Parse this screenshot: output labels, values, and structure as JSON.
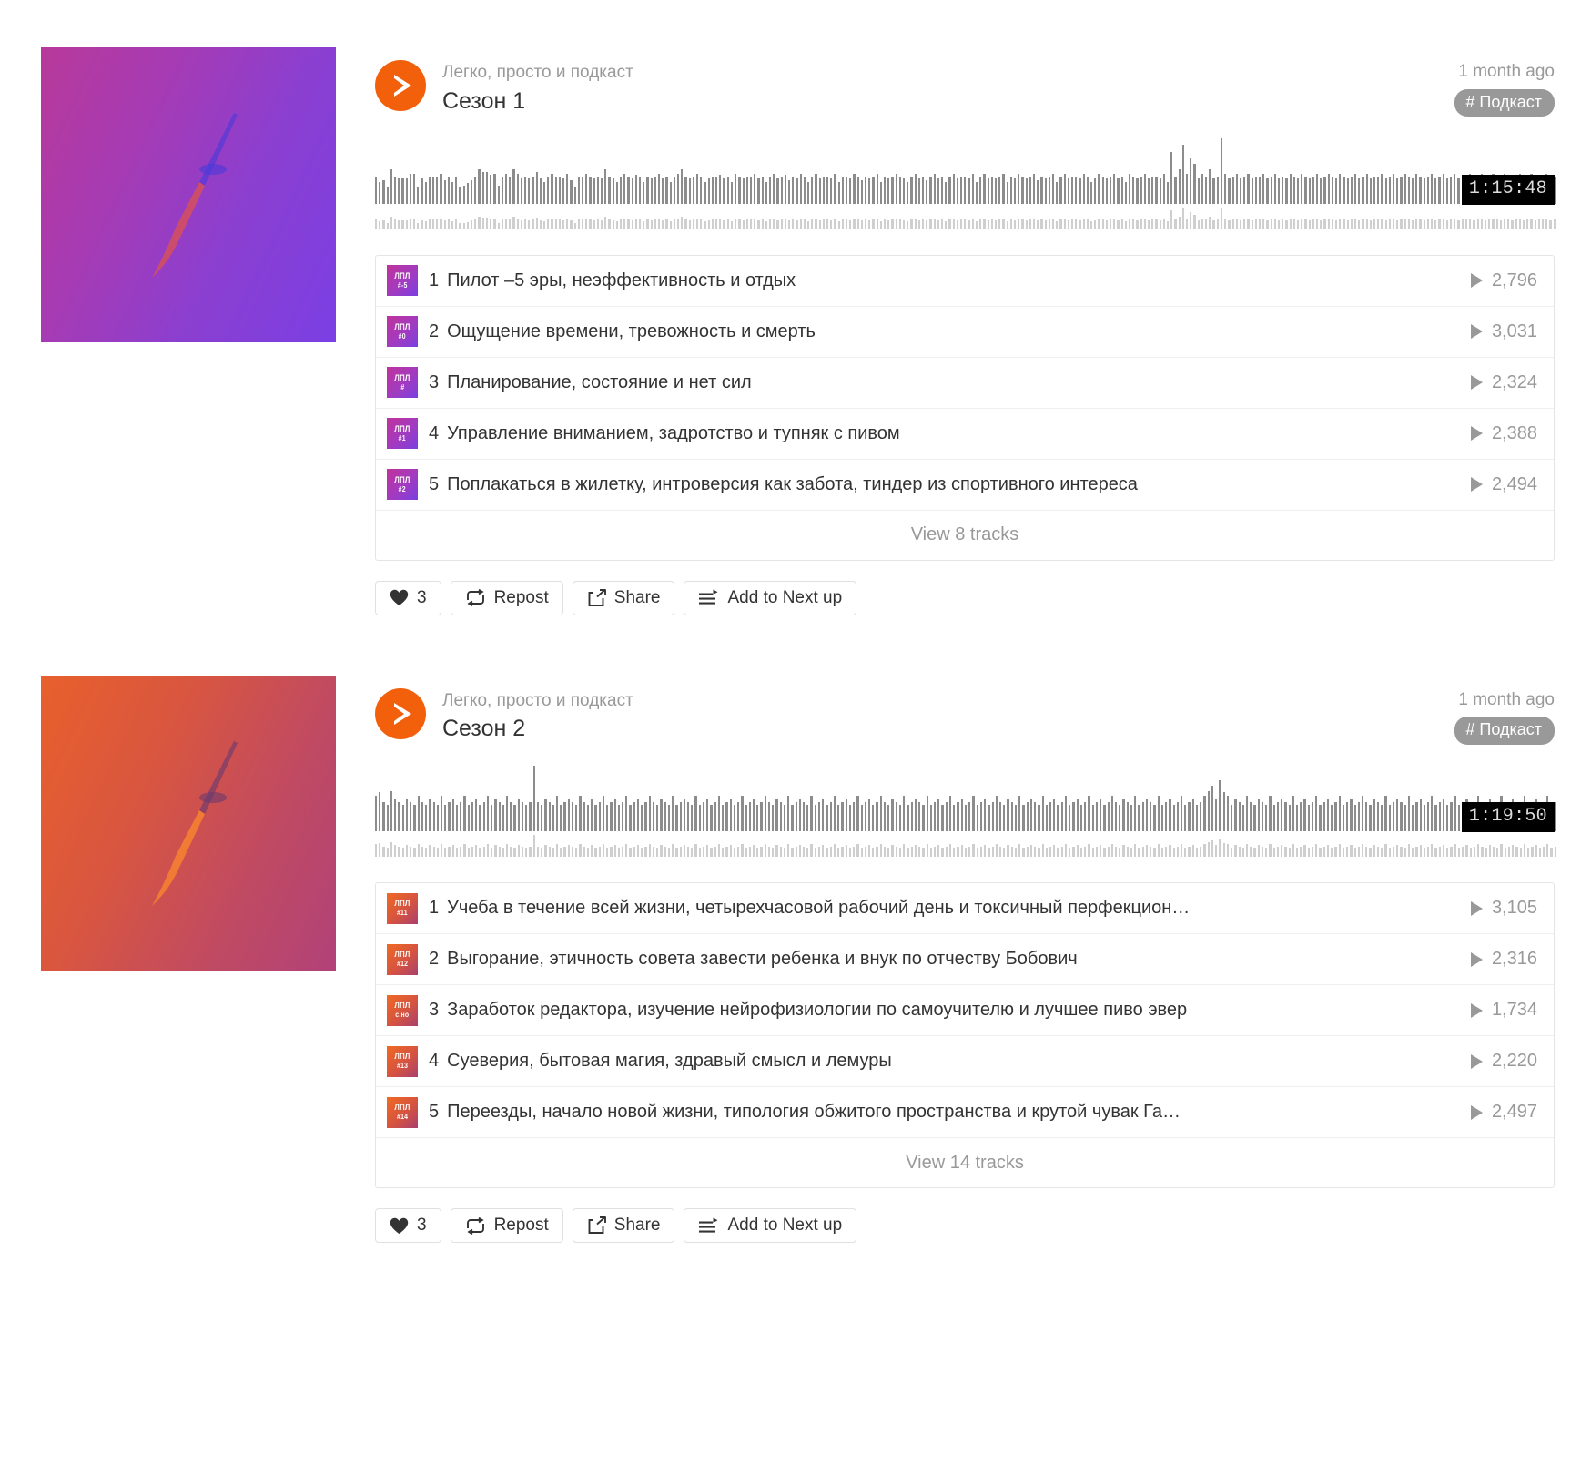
{
  "playlists": [
    {
      "artist": "Легко, просто и подкаст",
      "title": "Сезон 1",
      "ago": "1 month ago",
      "tag": "# Подкаст",
      "duration": "1:15:48",
      "artwork_colors": {
        "from": "#b8399a",
        "to": "#7b3fe4"
      },
      "view_all": "View 8 tracks",
      "tracks": [
        {
          "num": "1",
          "title": "Пилот –5 эры, неэффективность и отдых",
          "plays": "2,796",
          "thumb_line1": "ЛПЛ",
          "thumb_line2": "#-5"
        },
        {
          "num": "2",
          "title": "Ощущение времени, тревожность и смерть",
          "plays": "3,031",
          "thumb_line1": "ЛПЛ",
          "thumb_line2": "#0"
        },
        {
          "num": "3",
          "title": "Планирование, состояние и нет сил",
          "plays": "2,324",
          "thumb_line1": "ЛПЛ",
          "thumb_line2": "#"
        },
        {
          "num": "4",
          "title": "Управление вниманием, задротство и тупняк с пивом",
          "plays": "2,388",
          "thumb_line1": "ЛПЛ",
          "thumb_line2": "#1"
        },
        {
          "num": "5",
          "title": "Поплакаться в жилетку, интроверсия как забота, тиндер из спортивного интереса",
          "plays": "2,494",
          "thumb_line1": "ЛПЛ",
          "thumb_line2": "#2"
        }
      ],
      "actions": {
        "likes": "3",
        "repost": "Repost",
        "share": "Share",
        "next_up": "Add to Next up"
      }
    },
    {
      "artist": "Легко, просто и подкаст",
      "title": "Сезон 2",
      "ago": "1 month ago",
      "tag": "# Подкаст",
      "duration": "1:19:50",
      "artwork_colors": {
        "from": "#e8602c",
        "to": "#b14279"
      },
      "view_all": "View 14 tracks",
      "tracks": [
        {
          "num": "1",
          "title": "Учеба в течение всей жизни, четырехчасовой рабочий день и токсичный перфекцион…",
          "plays": "3,105",
          "thumb_line1": "ЛПЛ",
          "thumb_line2": "#11"
        },
        {
          "num": "2",
          "title": "Выгорание, этичность совета завести ребенка и внук по отчеству Бобович",
          "plays": "2,316",
          "thumb_line1": "ЛПЛ",
          "thumb_line2": "#12"
        },
        {
          "num": "3",
          "title": "Заработок редактора, изучение нейрофизиологии по самоучителю и лучшее пиво эвер",
          "plays": "1,734",
          "thumb_line1": "ЛПЛ",
          "thumb_line2": "с.но"
        },
        {
          "num": "4",
          "title": "Суеверия, бытовая магия, здравый смысл и лемуры",
          "plays": "2,220",
          "thumb_line1": "ЛПЛ",
          "thumb_line2": "#13"
        },
        {
          "num": "5",
          "title": "Переезды, начало новой жизни, типология обжитого пространства и крутой чувак Га…",
          "plays": "2,497",
          "thumb_line1": "ЛПЛ",
          "thumb_line2": "#14"
        }
      ],
      "actions": {
        "likes": "3",
        "repost": "Repost",
        "share": "Share",
        "next_up": "Add to Next up"
      }
    }
  ],
  "icons": {
    "play": "play-icon",
    "heart": "heart-icon",
    "repost": "repost-icon",
    "share": "share-icon",
    "next_up": "add-to-next-up-icon"
  },
  "waveforms": {
    "s1": [
      41,
      33,
      36,
      26,
      52,
      41,
      38,
      38,
      38,
      45,
      45,
      26,
      38,
      33,
      41,
      41,
      41,
      45,
      36,
      41,
      33,
      41,
      26,
      27,
      31,
      36,
      41,
      52,
      48,
      48,
      44,
      45,
      27,
      41,
      45,
      41,
      52,
      45,
      38,
      41,
      38,
      41,
      48,
      38,
      33,
      41,
      45,
      41,
      41,
      38,
      45,
      36,
      26,
      41,
      41,
      45,
      41,
      38,
      41,
      38,
      52,
      41,
      38,
      33,
      41,
      45,
      41,
      38,
      44,
      41,
      33,
      41,
      38,
      41,
      45,
      38,
      41,
      33,
      41,
      45,
      52,
      41,
      38,
      41,
      45,
      41,
      33,
      38,
      41,
      41,
      44,
      38,
      41,
      33,
      45,
      41,
      38,
      41,
      41,
      45,
      38,
      41,
      33,
      41,
      45,
      38,
      41,
      44,
      36,
      41,
      38,
      45,
      41,
      33,
      41,
      45,
      38,
      41,
      41,
      38,
      45,
      33,
      41,
      41,
      38,
      45,
      41,
      36,
      41,
      38,
      41,
      45,
      33,
      41,
      38,
      41,
      45,
      41,
      38,
      33,
      41,
      45,
      38,
      41,
      36,
      41,
      45,
      38,
      41,
      33,
      41,
      45,
      38,
      41,
      41,
      38,
      45,
      33,
      41,
      45,
      38,
      41,
      38,
      41,
      45,
      33,
      41,
      38,
      45,
      41,
      38,
      41,
      45,
      36,
      41,
      38,
      41,
      45,
      33,
      41,
      45,
      38,
      41,
      41,
      38,
      45,
      41,
      33,
      38,
      45,
      41,
      38,
      41,
      45,
      38,
      41,
      33,
      45,
      41,
      38,
      41,
      45,
      38,
      41,
      41,
      38,
      45,
      33,
      78,
      41,
      52,
      90,
      45,
      70,
      60,
      38,
      45,
      41,
      52,
      38,
      41,
      100,
      45,
      38,
      41,
      45,
      38,
      41,
      45,
      38,
      41,
      41,
      45,
      38,
      41,
      45,
      38,
      41,
      38,
      45,
      41,
      38,
      45,
      41,
      38,
      41,
      45,
      38,
      41,
      45,
      41,
      38,
      45,
      41,
      38,
      41,
      45,
      38,
      41,
      45,
      38,
      41,
      41,
      45,
      38,
      41,
      45,
      38,
      41,
      45,
      41,
      38,
      45,
      41,
      38,
      41,
      45,
      38,
      41,
      45,
      38,
      41,
      45,
      38,
      41,
      41,
      45,
      38,
      41,
      45,
      38,
      41,
      45,
      41,
      38,
      45,
      41,
      38,
      41,
      45,
      38,
      41,
      45,
      38,
      41,
      41,
      45,
      38,
      41
    ],
    "s2": [
      55,
      60,
      45,
      41,
      62,
      50,
      45,
      41,
      50,
      45,
      41,
      55,
      45,
      41,
      50,
      45,
      41,
      55,
      41,
      45,
      50,
      41,
      45,
      55,
      41,
      45,
      50,
      41,
      45,
      55,
      41,
      50,
      45,
      41,
      55,
      45,
      41,
      50,
      45,
      41,
      45,
      100,
      45,
      41,
      50,
      45,
      41,
      55,
      41,
      45,
      50,
      45,
      41,
      55,
      45,
      41,
      50,
      41,
      45,
      55,
      41,
      45,
      50,
      41,
      45,
      55,
      41,
      45,
      50,
      41,
      45,
      55,
      45,
      41,
      50,
      45,
      41,
      55,
      41,
      45,
      50,
      45,
      41,
      55,
      41,
      45,
      50,
      41,
      45,
      55,
      41,
      45,
      50,
      41,
      45,
      55,
      41,
      45,
      50,
      41,
      45,
      55,
      45,
      41,
      50,
      45,
      41,
      55,
      41,
      45,
      50,
      45,
      41,
      55,
      41,
      45,
      50,
      41,
      45,
      55,
      41,
      45,
      50,
      41,
      45,
      55,
      41,
      45,
      50,
      41,
      45,
      55,
      45,
      41,
      50,
      45,
      41,
      55,
      41,
      45,
      50,
      45,
      41,
      55,
      41,
      45,
      50,
      41,
      45,
      55,
      41,
      45,
      50,
      41,
      45,
      55,
      41,
      45,
      50,
      41,
      45,
      55,
      45,
      41,
      50,
      45,
      41,
      55,
      41,
      45,
      50,
      45,
      41,
      55,
      41,
      45,
      50,
      41,
      45,
      55,
      41,
      45,
      50,
      41,
      45,
      55,
      41,
      45,
      50,
      41,
      45,
      55,
      45,
      41,
      50,
      45,
      41,
      55,
      41,
      45,
      50,
      45,
      41,
      55,
      41,
      45,
      50,
      41,
      45,
      55,
      41,
      45,
      50,
      41,
      45,
      55,
      62,
      70,
      50,
      78,
      60,
      55,
      41,
      50,
      45,
      41,
      55,
      45,
      41,
      50,
      45,
      41,
      55,
      41,
      45,
      50,
      45,
      41,
      55,
      41,
      45,
      50,
      41,
      45,
      55,
      41,
      45,
      50,
      41,
      45,
      55,
      41,
      45,
      50,
      41,
      45,
      55,
      45,
      41,
      50,
      45,
      41,
      55,
      41,
      45,
      50,
      45,
      41,
      55,
      41,
      45,
      50,
      41,
      45,
      55,
      41,
      45,
      50,
      41,
      45,
      55,
      41,
      45,
      50,
      41,
      45,
      55,
      45,
      41,
      50,
      45,
      41,
      55,
      41,
      45,
      50,
      45,
      41,
      55,
      41,
      45,
      50,
      41,
      45,
      55,
      41,
      45
    ]
  }
}
